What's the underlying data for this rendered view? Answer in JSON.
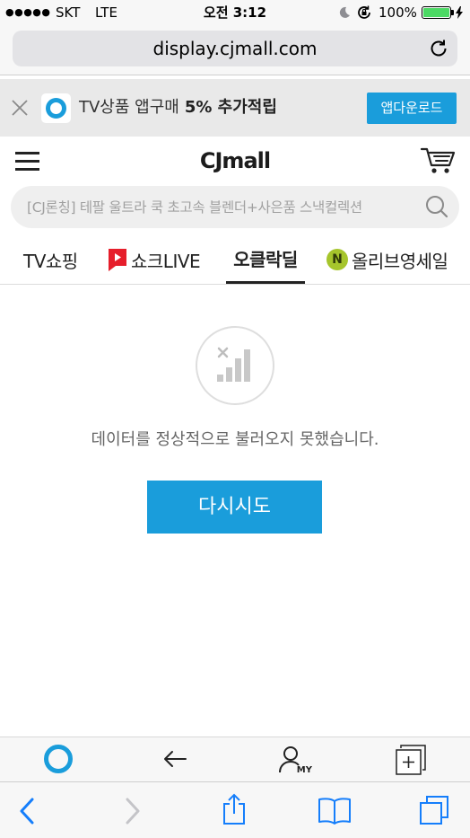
{
  "status_bar": {
    "signal": "●●●●●",
    "carrier": "SKT",
    "network": "LTE",
    "time": "오전 3:12",
    "battery_percent": "100%",
    "battery_level": 1.0,
    "icons": [
      "moon-icon",
      "orientation-lock-icon",
      "battery-icon",
      "charging-bolt-icon"
    ]
  },
  "browser": {
    "url": "display.cjmall.com",
    "icons": {
      "reload": "refresh-icon"
    }
  },
  "app_banner": {
    "text": "TV상품 앱구매",
    "highlight": "5% 추가적립",
    "download_label": "앱다운로드"
  },
  "header": {
    "logo": "CJmall"
  },
  "search": {
    "placeholder": "[CJ론칭] 테팔 울트라 쿡 초고속 블렌더+사은품 스낵컬렉션"
  },
  "tabs": [
    {
      "label": "TV쇼핑"
    },
    {
      "label": "쇼크LIVE",
      "icon": "live-play-icon"
    },
    {
      "label": "오클락딜"
    },
    {
      "label": "올리브영세일",
      "badge": "N"
    }
  ],
  "active_tab_index": 2,
  "error": {
    "message": "데이터를 정상적으로 불러오지 못했습니다.",
    "retry_label": "다시시도",
    "icon": "no-signal-icon"
  },
  "app_toolbar": {
    "my_label": "MY",
    "icons": [
      "home-ring-icon",
      "back-arrow-icon",
      "my-page-icon",
      "new-tab-plus-icon"
    ]
  },
  "safari_toolbar": {
    "icons": [
      "back-chevron-icon",
      "forward-chevron-icon",
      "share-icon",
      "bookmarks-icon",
      "tabs-icon"
    ]
  },
  "colors": {
    "accent": "#1a9ddb",
    "ios_blue": "#157efb",
    "live_red": "#e61e2b",
    "olive": "#a6c52c",
    "ink": "#222222"
  }
}
